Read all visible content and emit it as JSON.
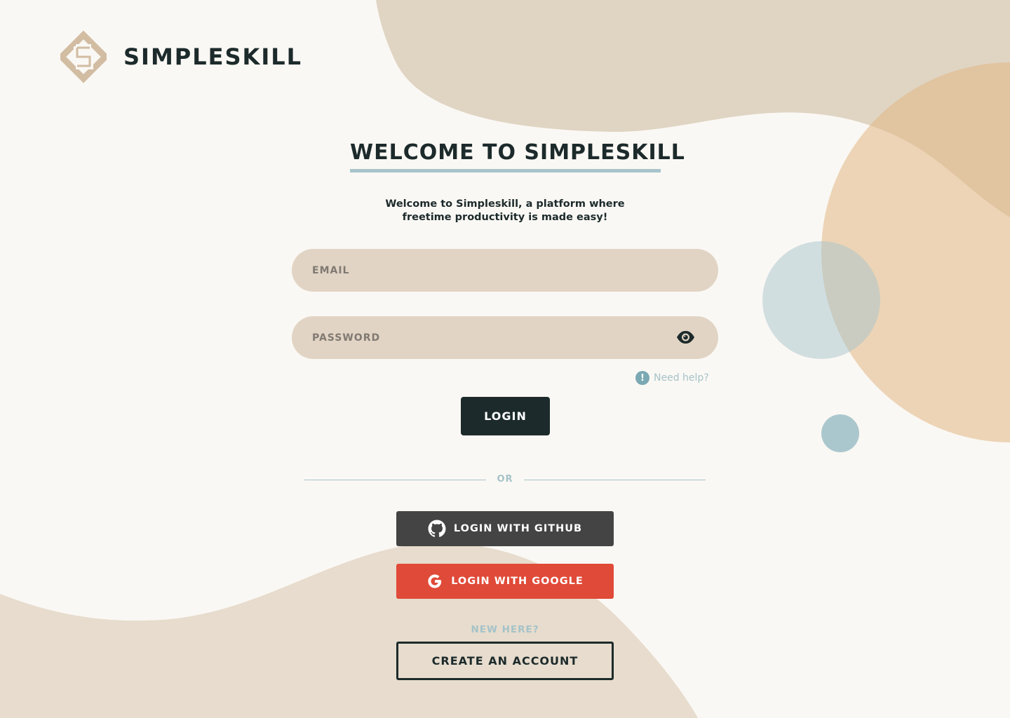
{
  "brand": {
    "name": "SIMPLESKILL",
    "logo_icon": "diamond-s-logo-icon"
  },
  "welcome": {
    "title": "WELCOME TO SIMPLESKILL",
    "subtitle_line1": "Welcome to Simpleskill, a platform where",
    "subtitle_line2": "freetime productivity is made easy!"
  },
  "form": {
    "email_placeholder": "EMAIL",
    "email_value": "",
    "password_placeholder": "PASSWORD",
    "password_value": "",
    "show_password_icon": "eye-icon",
    "help_icon": "exclamation-icon",
    "help_text": "Need help?",
    "login_label": "LOGIN"
  },
  "divider": {
    "label": "OR"
  },
  "social": {
    "github_label": "LOGIN WITH GITHUB",
    "github_icon": "github-icon",
    "google_label": "LOGIN WITH GOOGLE",
    "google_icon": "google-icon"
  },
  "signup": {
    "prompt": "NEW HERE?",
    "create_label": "CREATE AN ACCOUNT"
  },
  "colors": {
    "background": "#faf8f4",
    "primary_dark": "#1c2a2b",
    "field_bg": "#e1d4c4",
    "accent_blue": "#a7c4cb",
    "github": "#444444",
    "google": "#e04a38",
    "orange_blob": "#e8cfaf"
  }
}
